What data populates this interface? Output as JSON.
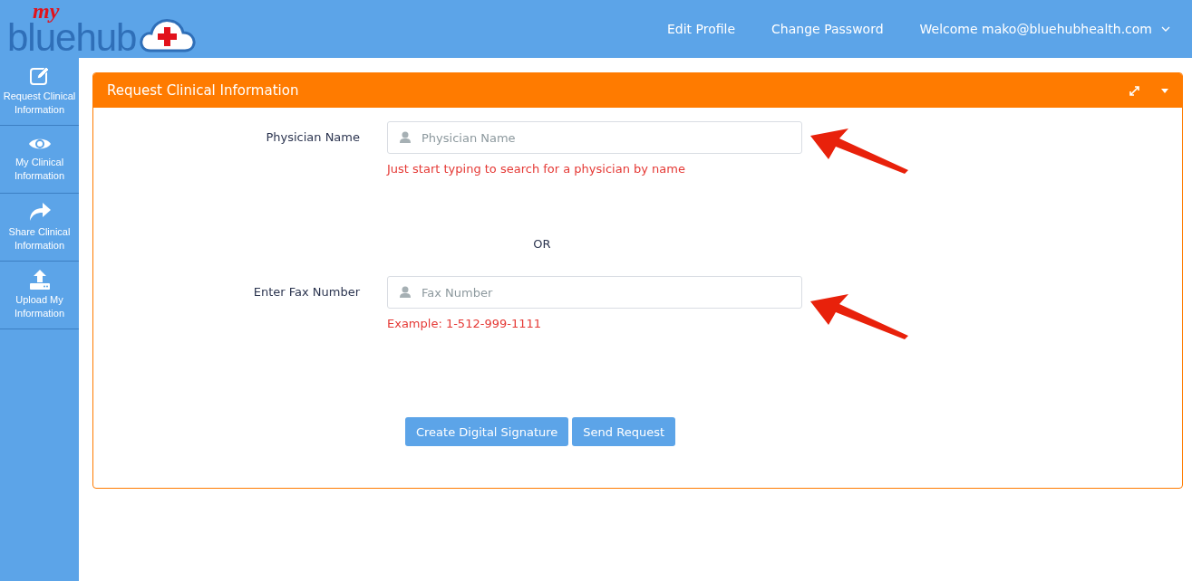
{
  "logo": {
    "script": "my",
    "word": "bluehub"
  },
  "nav": [
    "Edit Profile",
    "Change Password",
    "Welcome mako@bluehubhealth.com"
  ],
  "sidebar": {
    "items": [
      {
        "kind": "edit",
        "label": "Request Clinical Information"
      },
      {
        "kind": "eye",
        "label": "My Clinical Information"
      },
      {
        "kind": "share",
        "label": "Share Clinical Information"
      },
      {
        "kind": "upload",
        "label": "Upload My Information"
      }
    ]
  },
  "panel": {
    "title": "Request Clinical Information",
    "fields": [
      {
        "label": "Physician Name",
        "placeholder": "Physician Name",
        "hint": "Just start typing to search for a physician by name"
      },
      {
        "label": "Enter Fax Number",
        "placeholder": "Fax Number",
        "hint": "Example: 1-512-999-1111"
      }
    ],
    "separator": "OR",
    "buttons": [
      "Create Digital Signature",
      "Send Request"
    ]
  }
}
